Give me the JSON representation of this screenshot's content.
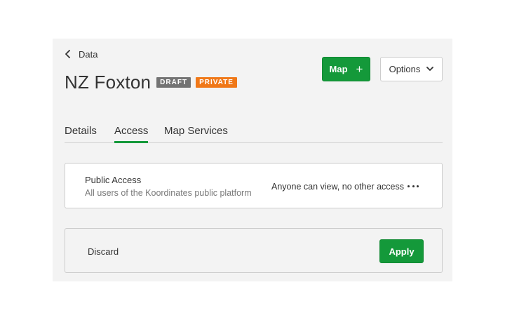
{
  "nav": {
    "back_label": "Data",
    "back_icon": "chevron-left-icon"
  },
  "header": {
    "title": "NZ Foxton",
    "badges": [
      {
        "label": "DRAFT",
        "color": "#737373"
      },
      {
        "label": "PRIVATE",
        "color": "#f07818"
      }
    ]
  },
  "actions": {
    "map_label": "Map",
    "map_icon": "plus-icon",
    "options_label": "Options",
    "options_icon": "chevron-down-icon"
  },
  "tabs": [
    {
      "label": "Details",
      "active": false
    },
    {
      "label": "Access",
      "active": true
    },
    {
      "label": "Map Services",
      "active": false
    }
  ],
  "access": {
    "title": "Public Access",
    "description": "All users of the Koordinates public platform",
    "level": "Anyone can view, no other access",
    "more_icon": "more-horizontal-icon"
  },
  "footer": {
    "discard_label": "Discard",
    "apply_label": "Apply"
  },
  "colors": {
    "accent": "#14993a",
    "panel_bg": "#f3f3f3",
    "border": "#cccccc"
  }
}
